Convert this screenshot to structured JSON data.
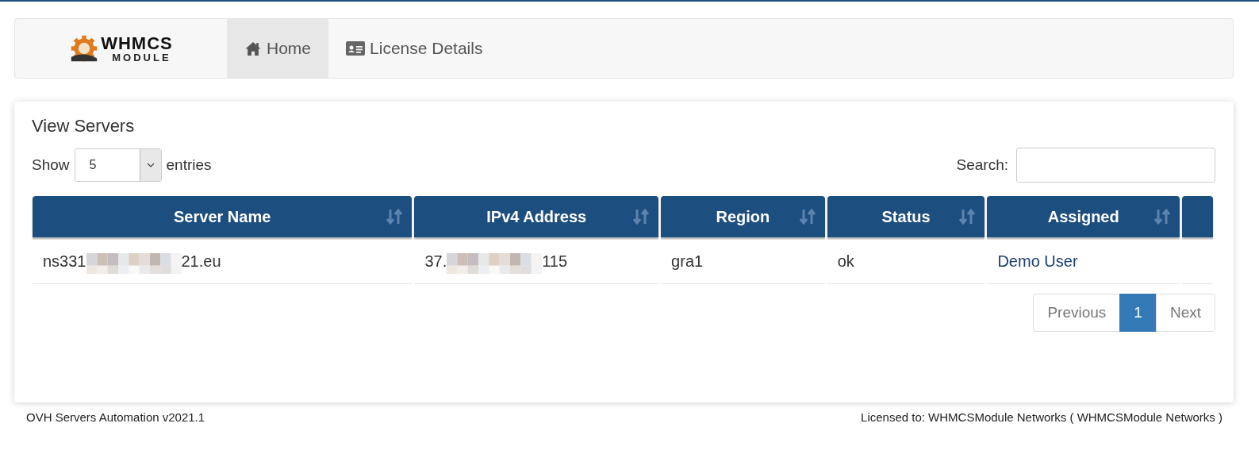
{
  "logo": {
    "line1": "WHMCS",
    "line2": "MODULE"
  },
  "nav": [
    {
      "label": "Home",
      "selected": true
    },
    {
      "label": "License Details",
      "selected": false
    }
  ],
  "panel": {
    "title": "View Servers"
  },
  "length_menu": {
    "before": "Show",
    "value": "5",
    "after": "entries"
  },
  "search": {
    "label": "Search:"
  },
  "table": {
    "columns": [
      {
        "label": "Server Name",
        "sortable": true
      },
      {
        "label": "IPv4 Address",
        "sortable": true
      },
      {
        "label": "Region",
        "sortable": true
      },
      {
        "label": "Status",
        "sortable": true
      },
      {
        "label": "Assigned",
        "sortable": true
      },
      {
        "sortable": false
      }
    ],
    "rows": [
      {
        "cells": [
          {
            "kind": "redacted",
            "start": "ns331",
            "end": "21.eu"
          },
          {
            "kind": "redacted",
            "start": "37.",
            "end": "115"
          },
          {
            "kind": "text",
            "text": "gra1"
          },
          {
            "kind": "text",
            "text": "ok"
          },
          {
            "kind": "link",
            "text": "Demo User"
          },
          {
            "kind": "empty"
          }
        ]
      }
    ]
  },
  "pagination": [
    {
      "label": "Previous",
      "selected": false
    },
    {
      "label": "1",
      "selected": true
    },
    {
      "label": "Next",
      "selected": false
    }
  ],
  "footer": {
    "left": "OVH Servers Automation v2021.1",
    "right": "Licensed to: WHMCSModule Networks ( WHMCSModule Networks )"
  }
}
